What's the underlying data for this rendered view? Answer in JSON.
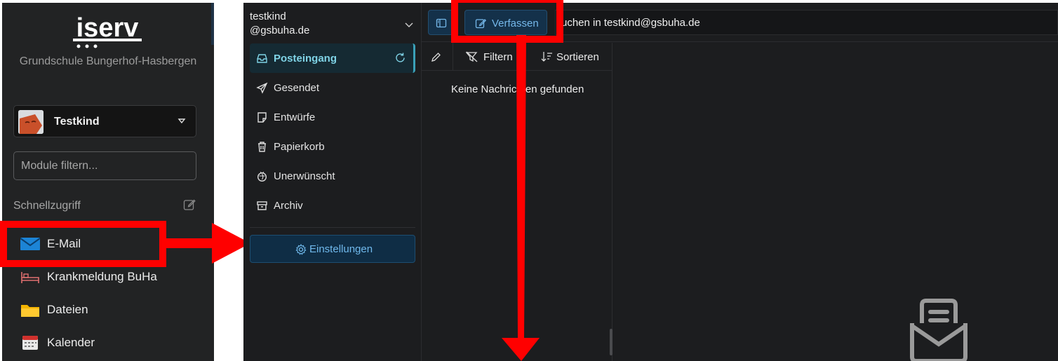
{
  "sidebar": {
    "logo_text": "iserv",
    "school_name": "Grundschule Bungerhof-Hasbergen",
    "user_name": "Testkind",
    "filter_placeholder": "Module filtern...",
    "quick_access_label": "Schnellzugriff",
    "items": [
      {
        "label": "E-Mail",
        "icon": "mail-icon"
      },
      {
        "label": "Krankmeldung BuHa",
        "icon": "bed-icon"
      },
      {
        "label": "Dateien",
        "icon": "folder-icon"
      },
      {
        "label": "Kalender",
        "icon": "calendar-icon"
      }
    ]
  },
  "mail": {
    "account_line1": "testkind",
    "account_line2": "@gsbuha.de",
    "folders": [
      {
        "label": "Posteingang",
        "icon": "inbox-icon",
        "active": true
      },
      {
        "label": "Gesendet",
        "icon": "send-icon"
      },
      {
        "label": "Entwürfe",
        "icon": "draft-icon"
      },
      {
        "label": "Papierkorb",
        "icon": "trash-icon"
      },
      {
        "label": "Unerwünscht",
        "icon": "spam-icon"
      },
      {
        "label": "Archiv",
        "icon": "archive-icon"
      }
    ],
    "settings_label": "Einstellungen",
    "compose_label": "Verfassen",
    "search_placeholder": "uchen in testkind@gsbuha.de",
    "filter_label": "Filtern",
    "sort_label": "Sortieren",
    "empty_message": "Keine Nachrichten gefunden"
  },
  "colors": {
    "annotation": "#ff0000",
    "accent": "#7fd3e6",
    "button_text": "#75b8ea"
  }
}
